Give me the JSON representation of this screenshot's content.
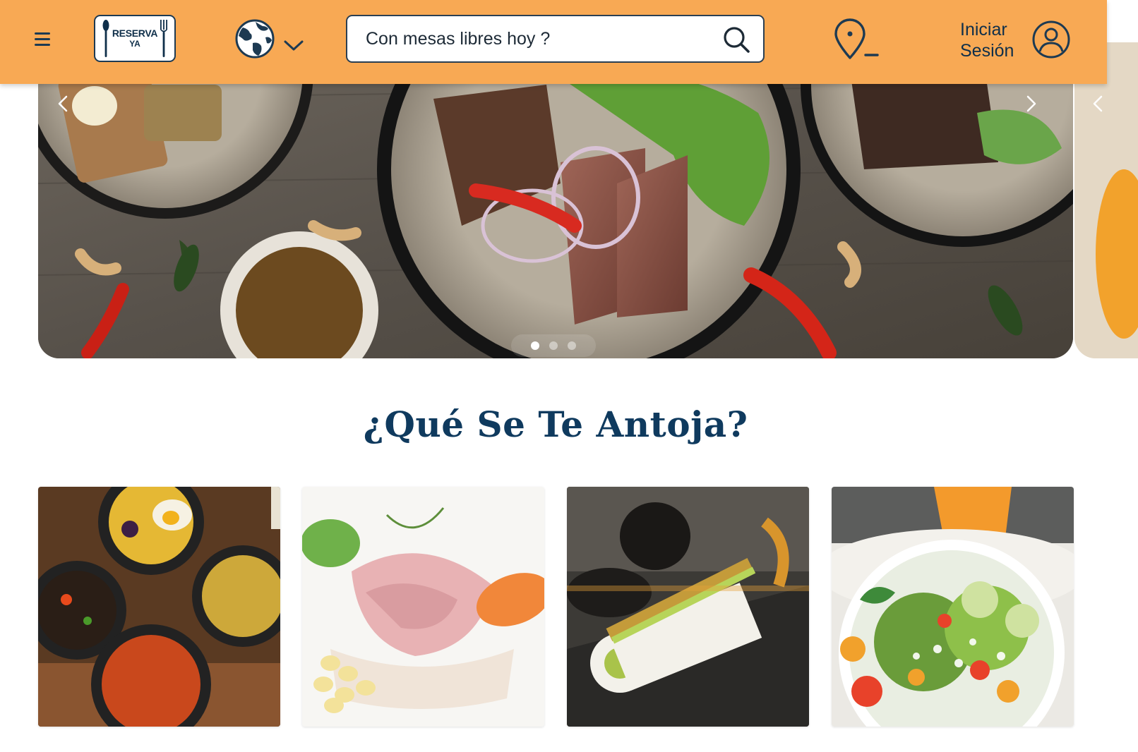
{
  "header": {
    "logo": {
      "line1": "RESERVA",
      "line2": "YA"
    },
    "search": {
      "placeholder": "Con mesas libres hoy ?"
    },
    "login_label": "Iniciar Sesión"
  },
  "carousel": {
    "slides": 3,
    "active_index": 0
  },
  "section": {
    "title": "¿Qué Se Te Antoja?"
  },
  "categories": [
    {
      "name": "peruvian-stews-card"
    },
    {
      "name": "ceviche-card"
    },
    {
      "name": "sushi-card"
    },
    {
      "name": "salad-card"
    }
  ],
  "colors": {
    "header_bg": "#f8a954",
    "primary_text": "#0f3a5e",
    "accent_border": "#1d3a52"
  }
}
